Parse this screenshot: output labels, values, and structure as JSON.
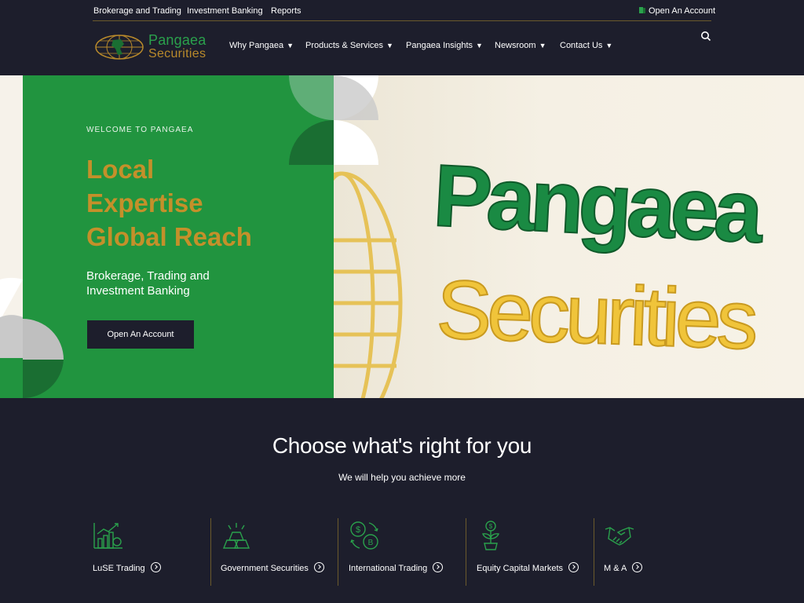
{
  "utility_nav": {
    "brokerage": "Brokerage and Trading",
    "investment_banking": "Investment Banking",
    "reports": "Reports",
    "open_account": "Open An Account"
  },
  "brand": {
    "name_line1": "Pangaea",
    "name_line2": "Securities"
  },
  "main_nav": [
    {
      "label": "Why Pangaea"
    },
    {
      "label": "Products & Services"
    },
    {
      "label": "Pangaea Insights"
    },
    {
      "label": "Newsroom"
    },
    {
      "label": "Contact Us"
    }
  ],
  "hero": {
    "eyebrow": "WELCOME TO PANGAEA",
    "headline_line1": "Local",
    "headline_line2": "Expertise",
    "headline_line3": "Global Reach",
    "subheading": "Brokerage, Trading and Investment Banking",
    "cta_label": "Open An Account",
    "photo_sign_line1": "Pangaea",
    "photo_sign_line2": "Securities"
  },
  "offerings": {
    "title": "Choose what's right for you",
    "subtitle": "We will help you achieve more",
    "items": [
      {
        "label": "LuSE Trading",
        "icon": "chart-growth-icon"
      },
      {
        "label": "Government Securities",
        "icon": "gold-bars-icon"
      },
      {
        "label": "International Trading",
        "icon": "currency-exchange-icon"
      },
      {
        "label": "Equity Capital Markets",
        "icon": "money-plant-icon"
      },
      {
        "label": "M & A",
        "icon": "handshake-icon"
      }
    ]
  },
  "colors": {
    "dark": "#1d1e2c",
    "green": "#21943f",
    "gold": "#c4902a"
  }
}
